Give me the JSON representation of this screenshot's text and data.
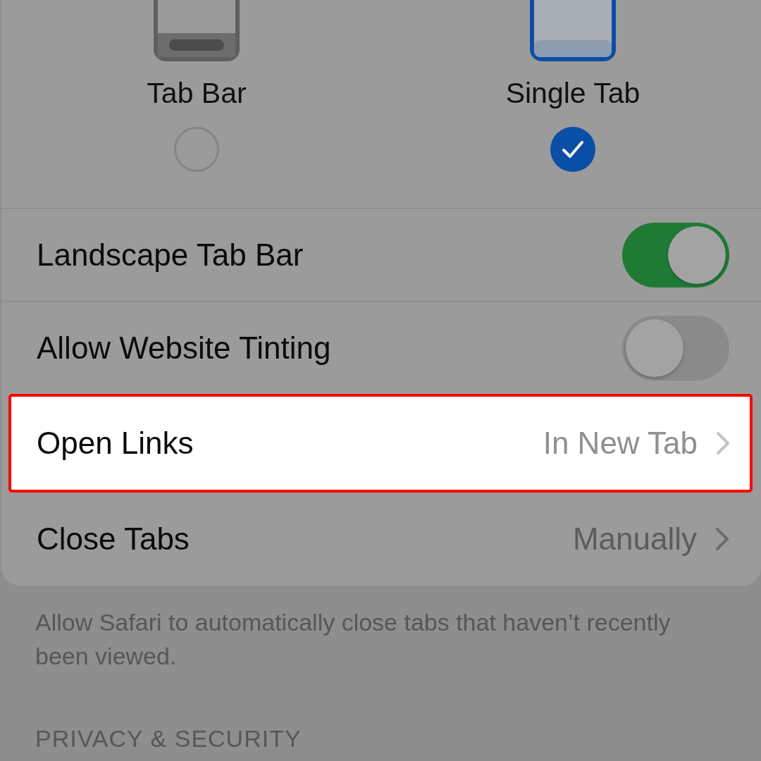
{
  "layout_options": [
    {
      "label": "Tab Bar",
      "selected": false
    },
    {
      "label": "Single Tab",
      "selected": true
    }
  ],
  "rows": [
    {
      "kind": "toggle",
      "label": "Landscape Tab Bar",
      "on": true
    },
    {
      "kind": "toggle",
      "label": "Allow Website Tinting",
      "on": false
    },
    {
      "kind": "link",
      "label": "Open Links",
      "value": "In New Tab",
      "highlighted": true
    },
    {
      "kind": "link",
      "label": "Close Tabs",
      "value": "Manually",
      "highlighted": false
    }
  ],
  "footer": "Allow Safari to automatically close tabs that haven’t recently been viewed.",
  "section_header": "PRIVACY & SECURITY"
}
